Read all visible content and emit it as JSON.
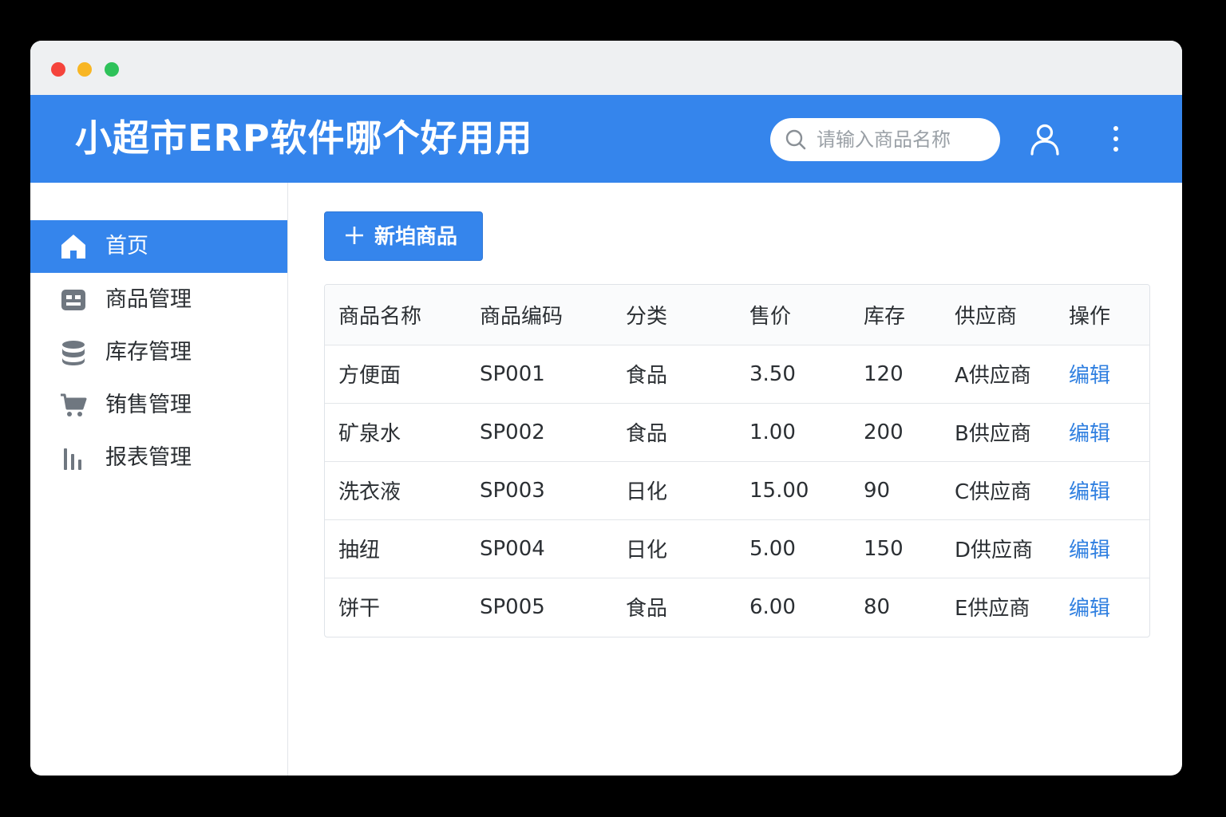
{
  "header": {
    "title": "小超市ERP软件哪个好用用",
    "search_placeholder": "请输入商品名称",
    "icons": [
      "search-icon",
      "user-icon",
      "more-vertical-icon"
    ]
  },
  "colors": {
    "accent": "#3585ec",
    "link": "#2f7fe0",
    "titlebar": "#eef0f2"
  },
  "sidebar": {
    "items": [
      {
        "label": "首页",
        "icon": "home-icon",
        "active": true
      },
      {
        "label": "商品管理",
        "icon": "product-box-icon",
        "active": false
      },
      {
        "label": "库存管理",
        "icon": "database-stack-icon",
        "active": false
      },
      {
        "label": "铕售管理",
        "icon": "cart-icon",
        "active": false
      },
      {
        "label": "报表管理",
        "icon": "bar-chart-icon",
        "active": false
      }
    ]
  },
  "toolbar": {
    "add_label": "新垍商品"
  },
  "table": {
    "columns": [
      "商品名称",
      "商品编码",
      "分类",
      "售价",
      "库存",
      "供应商",
      "操作"
    ],
    "rows": [
      [
        "方便面",
        "SP001",
        "食品",
        "3.50",
        "120",
        "A供应商",
        "编辑"
      ],
      [
        "矿泉水",
        "SP002",
        "食品",
        "1.00",
        "200",
        "B供应商",
        "编辑"
      ],
      [
        "洗衣液",
        "SP003",
        "日化",
        "15.00",
        "90",
        "C供应商",
        "编辑"
      ],
      [
        "抽纽",
        "SP004",
        "日化",
        "5.00",
        "150",
        "D供应商",
        "编辑"
      ],
      [
        "饼干",
        "SP005",
        "食品",
        "6.00",
        "80",
        "E供应商",
        "编辑"
      ]
    ]
  }
}
